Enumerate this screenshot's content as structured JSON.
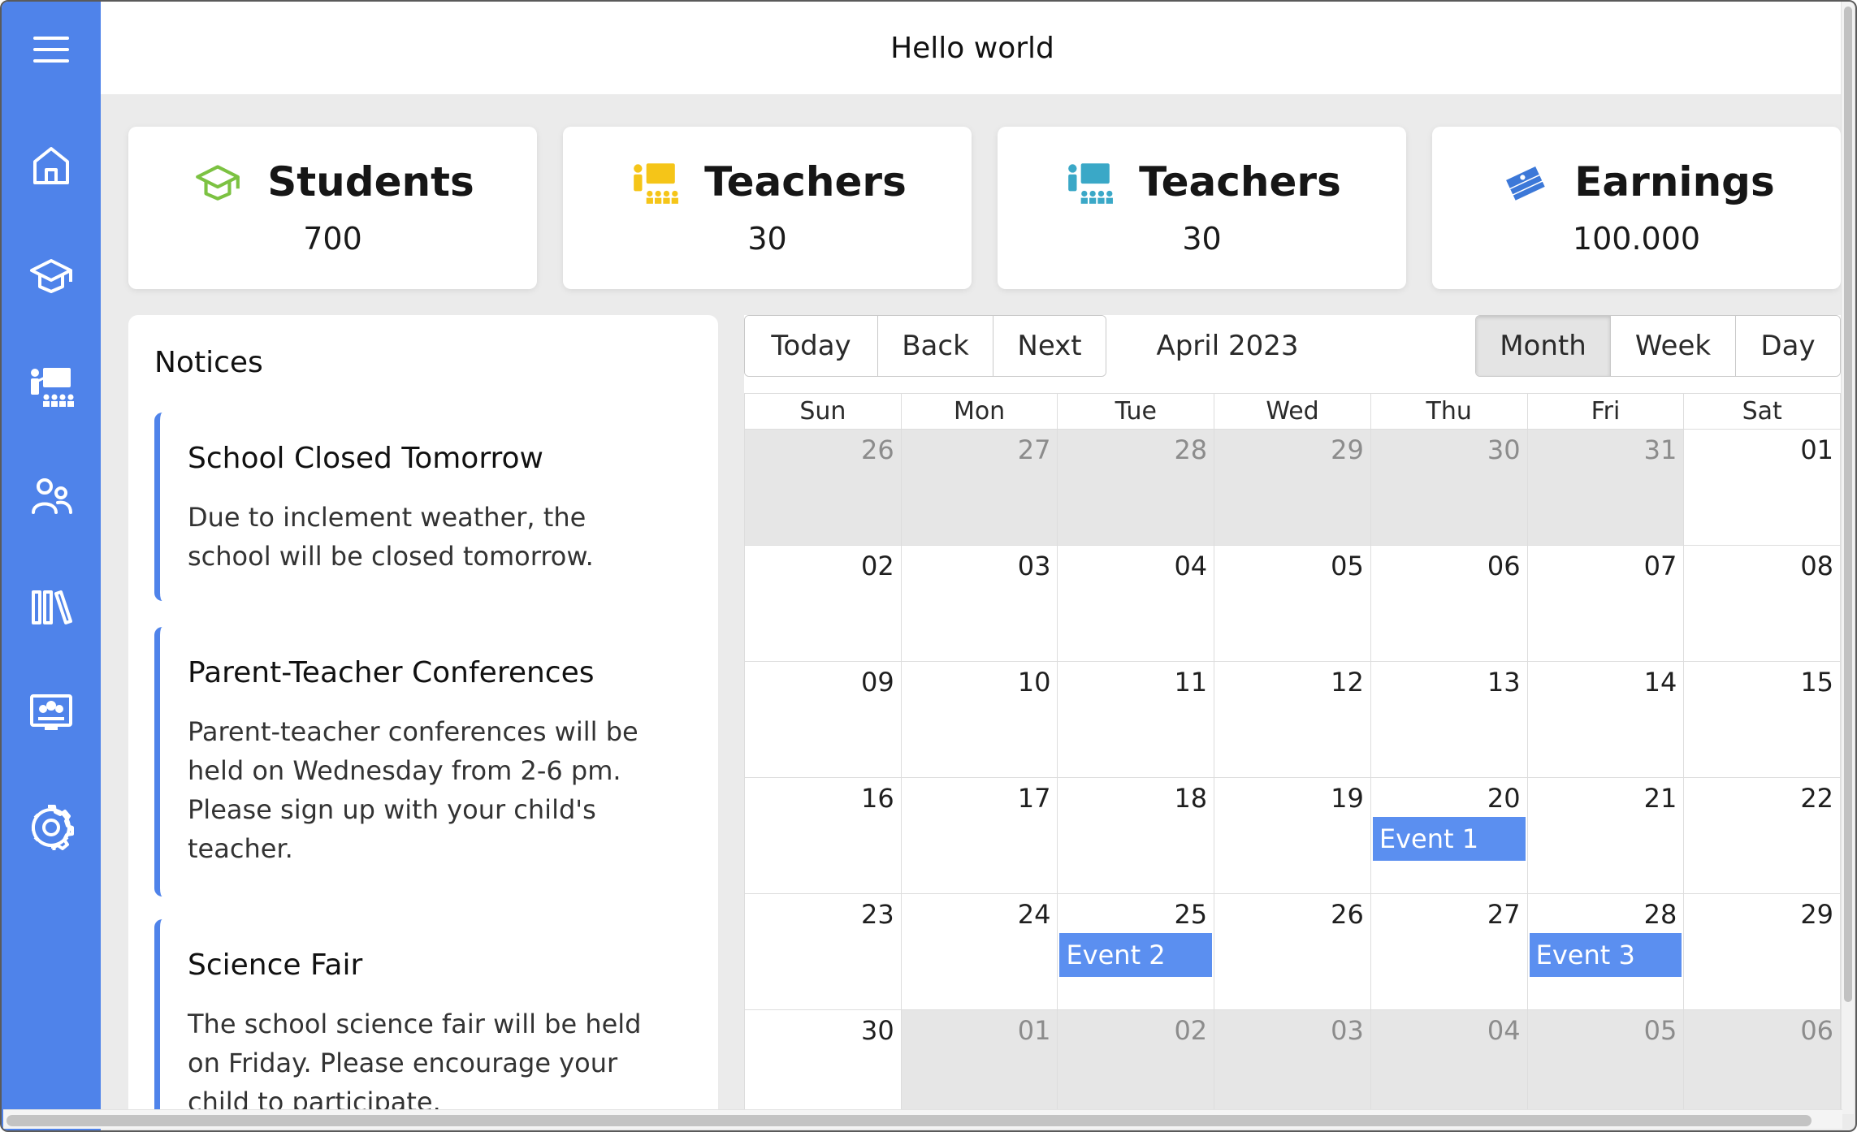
{
  "header": {
    "title": "Hello world"
  },
  "sidebar": {
    "items": [
      {
        "name": "menu-icon"
      },
      {
        "name": "home-icon"
      },
      {
        "name": "graduation-cap-icon"
      },
      {
        "name": "teacher-board-icon"
      },
      {
        "name": "people-icon"
      },
      {
        "name": "library-icon"
      },
      {
        "name": "classroom-screen-icon"
      },
      {
        "name": "gear-icon"
      }
    ]
  },
  "stats": [
    {
      "title": "Students",
      "value": "700",
      "icon": "graduation-cap-icon",
      "color": "#7cc242"
    },
    {
      "title": "Teachers",
      "value": "30",
      "icon": "teacher-board-icon",
      "color": "#f5c518"
    },
    {
      "title": "Teachers",
      "value": "30",
      "icon": "teacher-board-icon",
      "color": "#3aa8c7"
    },
    {
      "title": "Earnings",
      "value": "100.000",
      "icon": "money-stack-icon",
      "color": "#3c78d8"
    }
  ],
  "notices": {
    "title": "Notices",
    "items": [
      {
        "title": "School Closed Tomorrow",
        "body": "Due to inclement weather, the school will be closed tomorrow."
      },
      {
        "title": "Parent-Teacher Conferences",
        "body": "Parent-teacher conferences will be held on Wednesday from 2-6 pm. Please sign up with your child's teacher."
      },
      {
        "title": "Science Fair",
        "body": "The school science fair will be held on Friday. Please encourage your child to participate."
      }
    ]
  },
  "calendar": {
    "toolbar": {
      "today": "Today",
      "back": "Back",
      "next": "Next",
      "label": "April 2023",
      "month": "Month",
      "week": "Week",
      "day": "Day",
      "active_view": "Month"
    },
    "weekdays": [
      "Sun",
      "Mon",
      "Tue",
      "Wed",
      "Thu",
      "Fri",
      "Sat"
    ],
    "weeks": [
      [
        {
          "d": "26",
          "off": true
        },
        {
          "d": "27",
          "off": true
        },
        {
          "d": "28",
          "off": true
        },
        {
          "d": "29",
          "off": true
        },
        {
          "d": "30",
          "off": true
        },
        {
          "d": "31",
          "off": true
        },
        {
          "d": "01",
          "off": false
        }
      ],
      [
        {
          "d": "02",
          "off": false
        },
        {
          "d": "03",
          "off": false
        },
        {
          "d": "04",
          "off": false
        },
        {
          "d": "05",
          "off": false
        },
        {
          "d": "06",
          "off": false
        },
        {
          "d": "07",
          "off": false
        },
        {
          "d": "08",
          "off": false
        }
      ],
      [
        {
          "d": "09",
          "off": false
        },
        {
          "d": "10",
          "off": false
        },
        {
          "d": "11",
          "off": false
        },
        {
          "d": "12",
          "off": false
        },
        {
          "d": "13",
          "off": false
        },
        {
          "d": "14",
          "off": false
        },
        {
          "d": "15",
          "off": false
        }
      ],
      [
        {
          "d": "16",
          "off": false
        },
        {
          "d": "17",
          "off": false
        },
        {
          "d": "18",
          "off": false
        },
        {
          "d": "19",
          "off": false
        },
        {
          "d": "20",
          "off": false,
          "event": "Event 1"
        },
        {
          "d": "21",
          "off": false
        },
        {
          "d": "22",
          "off": false
        }
      ],
      [
        {
          "d": "23",
          "off": false
        },
        {
          "d": "24",
          "off": false
        },
        {
          "d": "25",
          "off": false,
          "event": "Event 2"
        },
        {
          "d": "26",
          "off": false
        },
        {
          "d": "27",
          "off": false
        },
        {
          "d": "28",
          "off": false,
          "event": "Event 3"
        },
        {
          "d": "29",
          "off": false
        }
      ],
      [
        {
          "d": "30",
          "off": false
        },
        {
          "d": "01",
          "off": true
        },
        {
          "d": "02",
          "off": true
        },
        {
          "d": "03",
          "off": true
        },
        {
          "d": "04",
          "off": true
        },
        {
          "d": "05",
          "off": true
        },
        {
          "d": "06",
          "off": true
        }
      ]
    ],
    "event_color": "#5b8ff0"
  },
  "theme": {
    "sidebar_color": "#4f83ea",
    "accent": "#4f83ea"
  }
}
